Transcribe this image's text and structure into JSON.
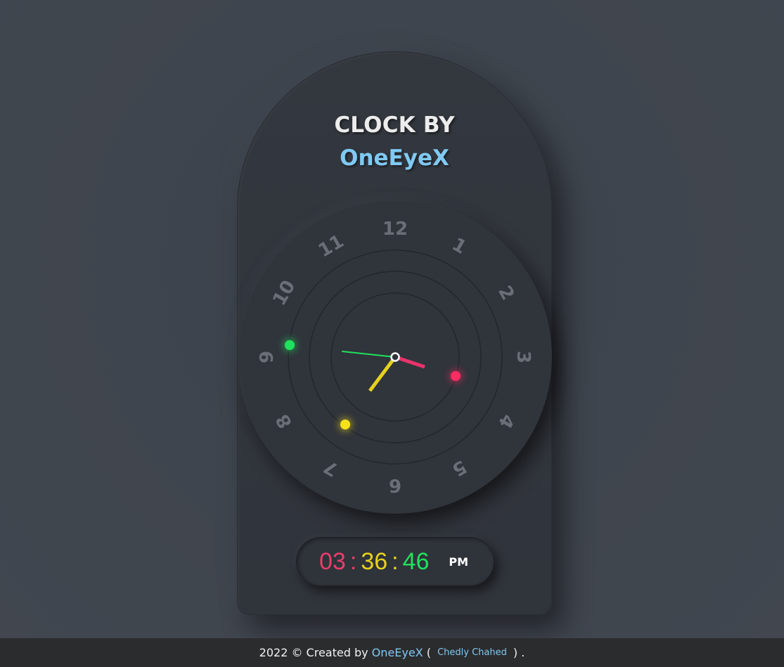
{
  "header": {
    "title": "CLOCK BY",
    "brand": "OneEyeX"
  },
  "dial": {
    "numbers": [
      "12",
      "1",
      "2",
      "3",
      "4",
      "5",
      "6",
      "7",
      "8",
      "9",
      "10",
      "11"
    ],
    "hand_colors": {
      "hour": "#e6d21c",
      "minute": "#e8336b",
      "second": "#1fe35c",
      "center_ring": "#ffffff"
    },
    "indicator_colors": {
      "green": "#1fe35c",
      "pink": "#ff2b63",
      "yellow": "#f7e11a"
    }
  },
  "digital": {
    "hours": "03",
    "sep1": ":",
    "minutes": "36",
    "sep2": ":",
    "seconds": "46",
    "ampm": "PM"
  },
  "footer": {
    "prefix": "2022 © Created by ",
    "brand_link": "OneEyeX",
    "open_paren": " ( ",
    "author_link": "Chedly Chahed",
    "close_paren": " ) ."
  }
}
